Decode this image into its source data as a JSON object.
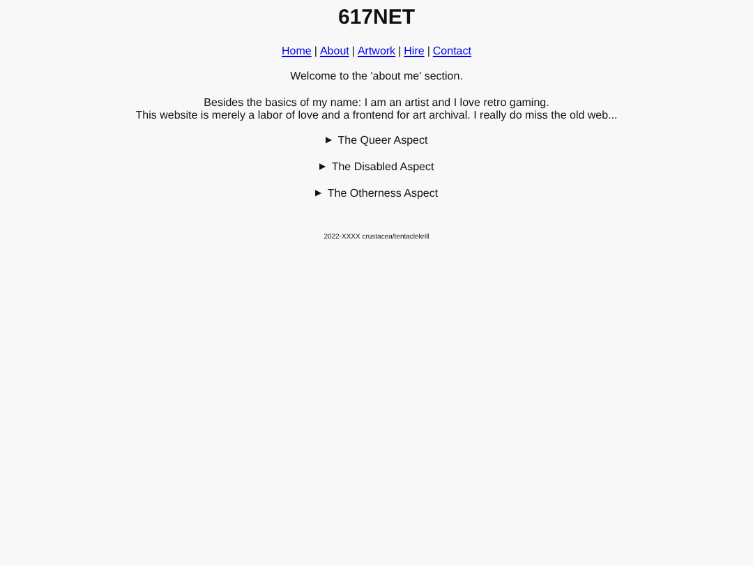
{
  "title": "617NET",
  "nav": [
    {
      "label": "Home"
    },
    {
      "label": "About"
    },
    {
      "label": "Artwork"
    },
    {
      "label": "Hire"
    },
    {
      "label": "Contact"
    }
  ],
  "nav_separator": "|",
  "welcome": "Welcome to the 'about me' section.",
  "intro_lines": [
    "Besides the basics of my name: I am an artist and I love retro gaming.",
    "This website is merely a labor of love and a frontend for art archival. I really do miss the old web..."
  ],
  "sections": [
    {
      "marker": "▶",
      "label": "The Queer Aspect",
      "expanded": false
    },
    {
      "marker": "▶",
      "label": "The Disabled Aspect",
      "expanded": false
    },
    {
      "marker": "▶",
      "label": "The Otherness Aspect",
      "expanded": false
    }
  ],
  "footer": "2022-XXXX crustacea/tentaclekrill"
}
